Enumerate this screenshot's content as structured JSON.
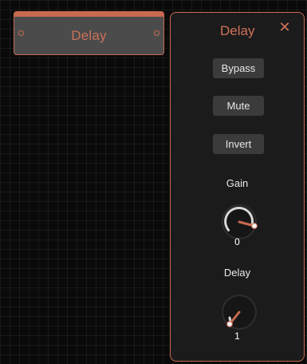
{
  "node": {
    "title": "Delay"
  },
  "panel": {
    "title": "Delay",
    "close_glyph": "✕",
    "buttons": {
      "bypass": "Bypass",
      "mute": "Mute",
      "invert": "Invert"
    },
    "knobs": [
      {
        "label": "Gain",
        "value": "0"
      },
      {
        "label": "Delay",
        "value": "1"
      }
    ]
  },
  "colors": {
    "accent": "#c86a50",
    "node_fill": "#4b4b4b",
    "panel_bg": "#1b1b1b",
    "button_bg": "#3b3b3b",
    "canvas_bg": "#0a0a0a"
  }
}
